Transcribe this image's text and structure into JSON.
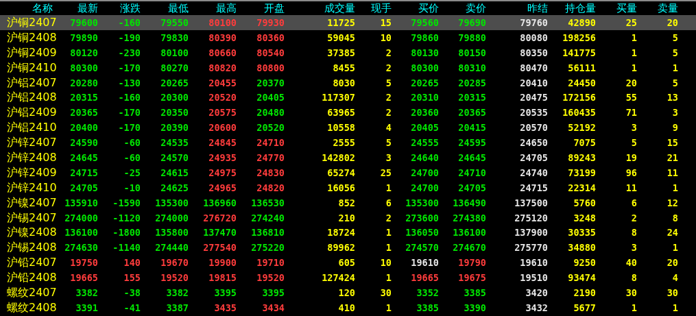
{
  "table": {
    "columns": [
      "名称",
      "最新",
      "涨跌",
      "最低",
      "最高",
      "开盘",
      "成交量",
      "现手",
      "买价",
      "卖价",
      "昨结",
      "持仓量",
      "买量",
      "卖量"
    ],
    "rows": [
      {
        "selected": true,
        "cells": [
          "沪铜2407",
          "79600",
          "-160",
          "79550",
          "80100",
          "79930",
          "11725",
          "15",
          "79560",
          "79690",
          "79760",
          "42890",
          "25",
          "20"
        ]
      },
      {
        "selected": false,
        "cells": [
          "沪铜2408",
          "79890",
          "-190",
          "79830",
          "80390",
          "80360",
          "59045",
          "10",
          "79860",
          "79880",
          "80080",
          "198256",
          "1",
          "5"
        ]
      },
      {
        "selected": false,
        "cells": [
          "沪铜2409",
          "80120",
          "-230",
          "80100",
          "80660",
          "80540",
          "37385",
          "2",
          "80130",
          "80150",
          "80350",
          "141775",
          "1",
          "5"
        ]
      },
      {
        "selected": false,
        "cells": [
          "沪铜2410",
          "80300",
          "-170",
          "80270",
          "80820",
          "80800",
          "8455",
          "2",
          "80300",
          "80310",
          "80470",
          "56111",
          "1",
          "1"
        ]
      },
      {
        "selected": false,
        "cells": [
          "沪铝2407",
          "20280",
          "-130",
          "20265",
          "20455",
          "20370",
          "8030",
          "5",
          "20265",
          "20285",
          "20410",
          "24450",
          "20",
          "5"
        ]
      },
      {
        "selected": false,
        "cells": [
          "沪铝2408",
          "20315",
          "-160",
          "20300",
          "20520",
          "20405",
          "117307",
          "2",
          "20310",
          "20315",
          "20475",
          "172156",
          "55",
          "13"
        ]
      },
      {
        "selected": false,
        "cells": [
          "沪铝2409",
          "20365",
          "-170",
          "20350",
          "20575",
          "20480",
          "63965",
          "2",
          "20360",
          "20365",
          "20535",
          "160435",
          "71",
          "3"
        ]
      },
      {
        "selected": false,
        "cells": [
          "沪铝2410",
          "20400",
          "-170",
          "20390",
          "20600",
          "20520",
          "10558",
          "4",
          "20405",
          "20415",
          "20570",
          "52192",
          "3",
          "9"
        ]
      },
      {
        "selected": false,
        "cells": [
          "沪锌2407",
          "24590",
          "-60",
          "24535",
          "24845",
          "24710",
          "2555",
          "5",
          "24555",
          "24595",
          "24650",
          "7075",
          "5",
          "15"
        ]
      },
      {
        "selected": false,
        "cells": [
          "沪锌2408",
          "24645",
          "-60",
          "24570",
          "24935",
          "24770",
          "142802",
          "3",
          "24640",
          "24645",
          "24705",
          "89243",
          "19",
          "21"
        ]
      },
      {
        "selected": false,
        "cells": [
          "沪锌2409",
          "24715",
          "-25",
          "24615",
          "24975",
          "24830",
          "65274",
          "25",
          "24700",
          "24710",
          "24740",
          "73199",
          "96",
          "11"
        ]
      },
      {
        "selected": false,
        "cells": [
          "沪锌2410",
          "24705",
          "-10",
          "24625",
          "24965",
          "24820",
          "16056",
          "1",
          "24700",
          "24705",
          "24715",
          "22314",
          "11",
          "1"
        ]
      },
      {
        "selected": false,
        "cells": [
          "沪镍2407",
          "135910",
          "-1590",
          "135300",
          "136960",
          "136530",
          "852",
          "6",
          "135300",
          "136490",
          "137500",
          "5760",
          "6",
          "12"
        ]
      },
      {
        "selected": false,
        "cells": [
          "沪锡2407",
          "274000",
          "-1120",
          "274000",
          "276720",
          "274240",
          "210",
          "2",
          "273600",
          "274380",
          "275120",
          "3248",
          "2",
          "8"
        ]
      },
      {
        "selected": false,
        "cells": [
          "沪镍2408",
          "136100",
          "-1800",
          "135800",
          "137470",
          "136810",
          "18724",
          "1",
          "136050",
          "136100",
          "137900",
          "30335",
          "8",
          "24"
        ]
      },
      {
        "selected": false,
        "cells": [
          "沪锡2408",
          "274630",
          "-1140",
          "274440",
          "277540",
          "275220",
          "89962",
          "1",
          "274570",
          "274670",
          "275770",
          "34880",
          "3",
          "1"
        ]
      },
      {
        "selected": false,
        "cells": [
          "沪铅2407",
          "19750",
          "140",
          "19670",
          "19900",
          "19710",
          "605",
          "10",
          "19610",
          "19790",
          "19610",
          "9250",
          "40",
          "20"
        ]
      },
      {
        "selected": false,
        "cells": [
          "沪铅2408",
          "19665",
          "155",
          "19520",
          "19815",
          "19520",
          "127424",
          "1",
          "19665",
          "19675",
          "19510",
          "93474",
          "8",
          "4"
        ]
      },
      {
        "selected": false,
        "cells": [
          "螺纹2407",
          "3382",
          "-38",
          "3382",
          "3395",
          "3395",
          "120",
          "30",
          "3352",
          "3385",
          "3420",
          "2190",
          "30",
          "30"
        ]
      },
      {
        "selected": false,
        "cells": [
          "螺纹2408",
          "3391",
          "-41",
          "3387",
          "3435",
          "3434",
          "410",
          "1",
          "3385",
          "3390",
          "3432",
          "5677",
          "1",
          "1"
        ]
      }
    ]
  }
}
